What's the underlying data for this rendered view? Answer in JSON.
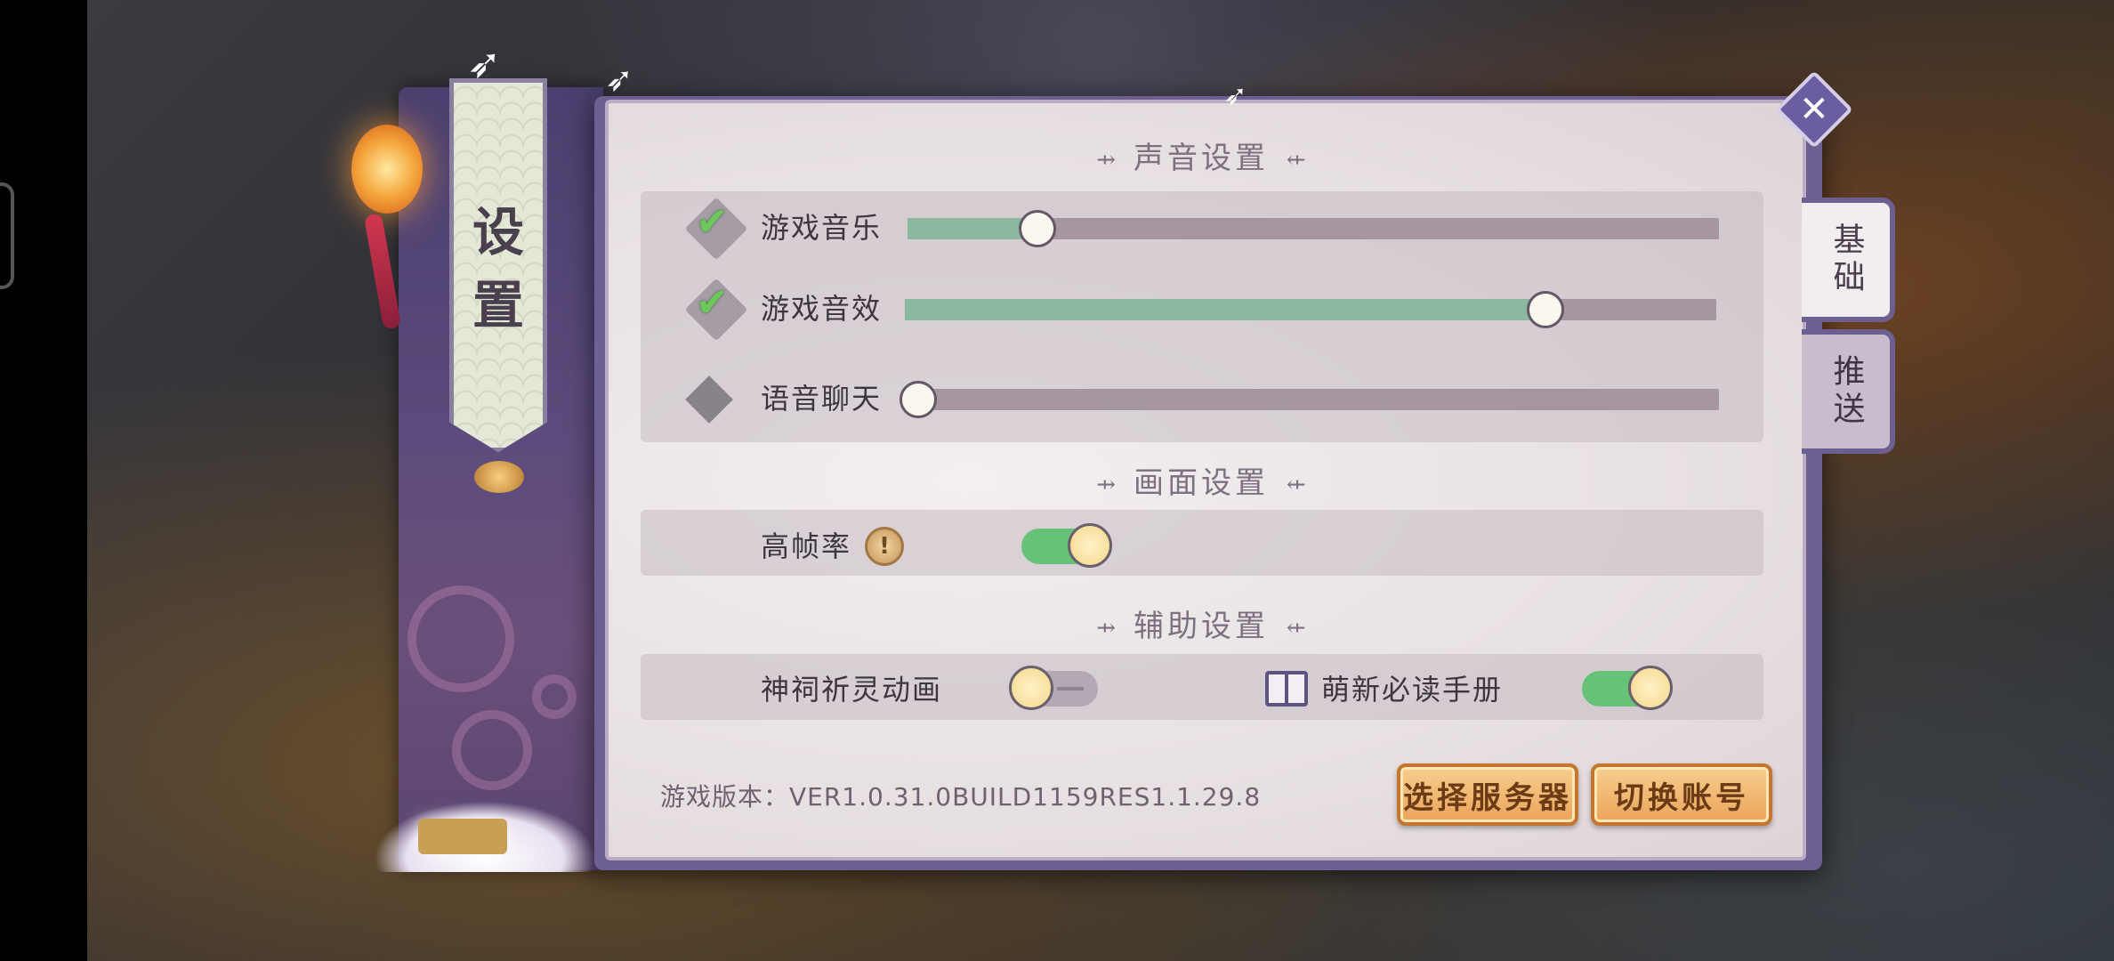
{
  "panel": {
    "title": "设置",
    "close_icon": "close-icon",
    "tabs": [
      {
        "label": "基础",
        "active": true
      },
      {
        "label": "推送",
        "active": false
      }
    ]
  },
  "sound": {
    "header": "声音设置",
    "music": {
      "label": "游戏音乐",
      "enabled": true,
      "level": 0.16
    },
    "effects": {
      "label": "游戏音效",
      "enabled": true,
      "level": 0.79
    },
    "voice": {
      "label": "语音聊天",
      "enabled": false,
      "level": 0.0
    }
  },
  "display": {
    "header": "画面设置",
    "high_fps": {
      "label": "高帧率",
      "on": true,
      "info_icon": "!"
    }
  },
  "assist": {
    "header": "辅助设置",
    "shrine_anim": {
      "label": "神祠祈灵动画",
      "on": false
    },
    "newbie_guide": {
      "label": "萌新必读手册",
      "on": true
    }
  },
  "footer": {
    "version": "游戏版本：VER1.0.31.0BUILD1159RES1.1.29.8",
    "select_server": "选择服务器",
    "switch_account": "切换账号"
  },
  "colors": {
    "slider_fill": "#8ab9a0",
    "toggle_on": "#66c276",
    "button": "#eba359",
    "frame": "#6d5f92"
  }
}
